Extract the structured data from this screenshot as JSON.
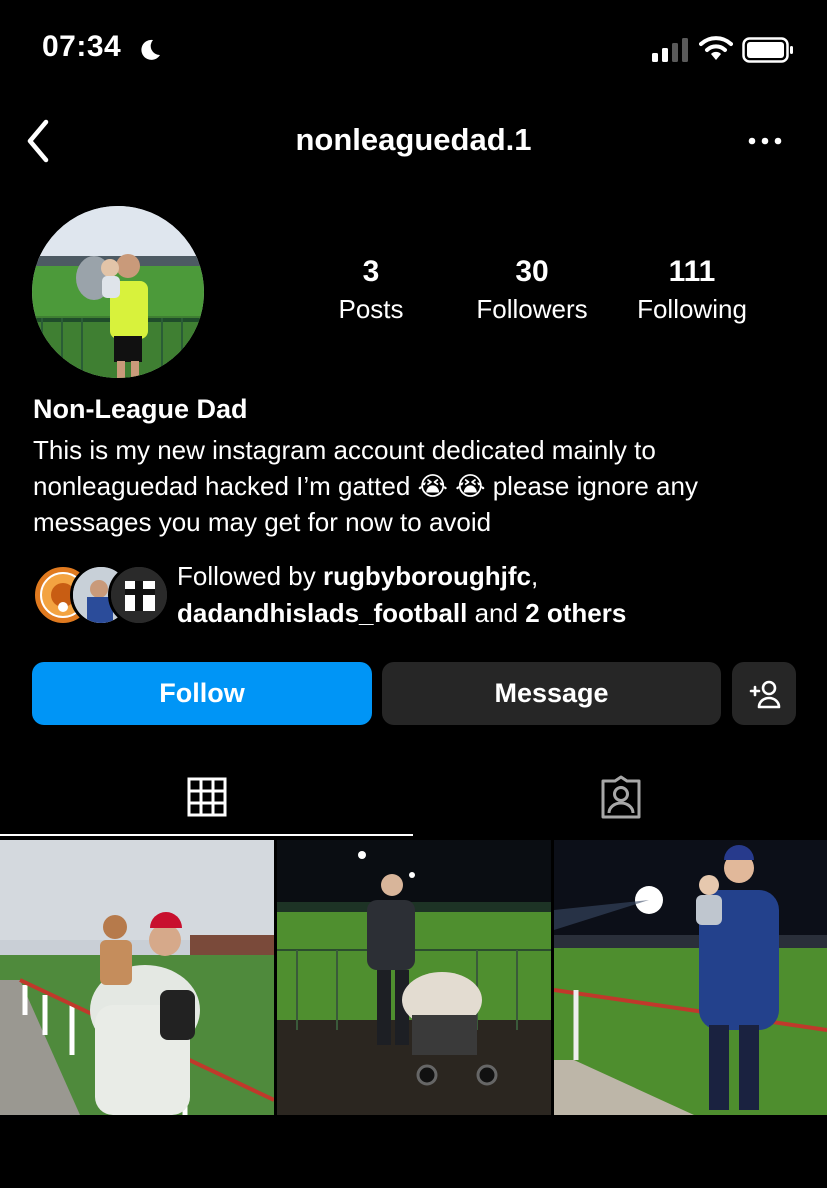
{
  "status_bar": {
    "time": "07:34",
    "icons": [
      "moon-icon",
      "signal-icon",
      "wifi-icon",
      "battery-icon"
    ]
  },
  "header": {
    "username": "nonleaguedad.1",
    "back_icon": "chevron-left-icon",
    "more_icon": "more-horizontal-icon"
  },
  "profile": {
    "stats": [
      {
        "value": "3",
        "label": "Posts"
      },
      {
        "value": "30",
        "label": "Followers"
      },
      {
        "value": "111",
        "label": "Following"
      }
    ],
    "name": "Non-League Dad",
    "bio": "This is my new instagram account dedicated mainly to nonleaguedad hacked I’m gatted 😭 😭  please ignore any messages you may get for now to avoid"
  },
  "followed_by": {
    "prefix": "Followed by ",
    "user1": "rugbyboroughjfc",
    "sep": ",",
    "user2": "dadandhislads_football",
    "and": " and ",
    "others": "2 others"
  },
  "actions": {
    "follow": "Follow",
    "message": "Message",
    "add_user_icon": "add-person-icon"
  },
  "tabs": [
    {
      "icon": "grid-icon",
      "active": true
    },
    {
      "icon": "tagged-person-icon",
      "active": false
    }
  ],
  "colors": {
    "accent": "#0095f6",
    "button_dark": "#262626",
    "background": "#000000"
  }
}
